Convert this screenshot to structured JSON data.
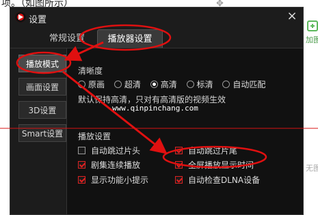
{
  "background": {
    "top_text": "项。（如图所示）",
    "move_icon": "move-cross-icon",
    "side_plus_label": "加图",
    "side_none_label": "无图"
  },
  "dialog": {
    "title": "设置",
    "close_symbol": "×",
    "tabs": [
      {
        "label": "常规设置",
        "active": false
      },
      {
        "label": "播放器设置",
        "active": true
      }
    ],
    "sidebar": [
      {
        "label": "播放模式",
        "active": true
      },
      {
        "label": "画面设置",
        "active": false
      },
      {
        "label": "3D设置",
        "active": false
      },
      {
        "label": "Smart设置",
        "active": false
      }
    ],
    "clarity": {
      "title": "清晰度",
      "options": [
        {
          "label": "原画",
          "selected": false
        },
        {
          "label": "超清",
          "selected": false
        },
        {
          "label": "高清",
          "selected": true
        },
        {
          "label": "标清",
          "selected": false
        },
        {
          "label": "自动匹配",
          "selected": false
        }
      ],
      "note": "默认保持高清，只对有高清版的视频生效"
    },
    "watermark": "www.qinpinchang.com",
    "playback": {
      "title": "播放设置",
      "checks": [
        {
          "label": "自动跳过片头",
          "checked": false
        },
        {
          "label": "自动跳过片尾",
          "checked": true
        },
        {
          "label": "剧集连续播放",
          "checked": true
        },
        {
          "label": "全屏播放显示时间",
          "checked": true
        },
        {
          "label": "显示功能小提示",
          "checked": true
        },
        {
          "label": "自动检查DLNA设备",
          "checked": true
        }
      ]
    }
  },
  "colors": {
    "annotation_red": "#e01010",
    "dialog_bg": "#1c1c1c"
  }
}
